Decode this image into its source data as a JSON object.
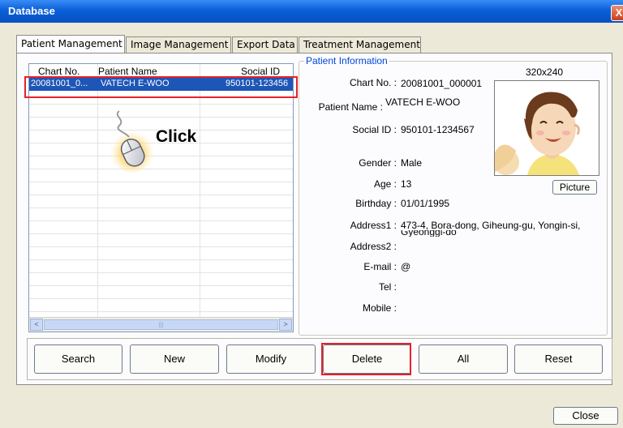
{
  "window": {
    "title": "Database",
    "close_glyph": "X"
  },
  "tabs": [
    {
      "label": "Patient Management"
    },
    {
      "label": "Image Management"
    },
    {
      "label": "Export Data"
    },
    {
      "label": "Treatment Management"
    }
  ],
  "grid": {
    "columns": [
      "Chart No.",
      "Patient Name",
      "Social ID"
    ],
    "rows": [
      {
        "chart_no": "20081001_0...",
        "name": "VATECH E-WOO",
        "social_id": "950101-123456"
      }
    ],
    "scroll_left": "<",
    "scroll_right": ">",
    "scroll_thumb_grip": "|||"
  },
  "overlay": {
    "click_text": "Click",
    "cursor_icon": "mouse-cursor-icon"
  },
  "patient_info": {
    "legend": "Patient Information",
    "photo_size": "320x240",
    "picture_button": "Picture",
    "fields": {
      "chart_no": {
        "label": "Chart No. :",
        "value": "20081001_000001"
      },
      "patient_name": {
        "label": "Patient Name :",
        "value": "VATECH E-WOO"
      },
      "social_id": {
        "label": "Social ID :",
        "value": "950101-1234567"
      },
      "gender": {
        "label": "Gender :",
        "value": "Male"
      },
      "age": {
        "label": "Age :",
        "value": "13"
      },
      "birthday": {
        "label": "Birthday :",
        "value": "01/01/1995"
      },
      "address1": {
        "label": "Address1 :",
        "value": "473-4, Bora-dong, Giheung-gu, Yongin-si,",
        "value_line2": "Gyeonggi-do"
      },
      "address2": {
        "label": "Address2 :",
        "value": ""
      },
      "email": {
        "label": "E-mail :",
        "value": "@"
      },
      "tel": {
        "label": "Tel :",
        "value": ""
      },
      "mobile": {
        "label": "Mobile :",
        "value": ""
      }
    }
  },
  "buttons": {
    "search": "Search",
    "new": "New",
    "modify": "Modify",
    "delete": "Delete",
    "all": "All",
    "reset": "Reset",
    "close": "Close"
  },
  "colors": {
    "highlight_box": "#e8202a",
    "selection": "#1e56b8",
    "legend_text": "#0046d5",
    "title_bar": "#0a5fd8"
  }
}
